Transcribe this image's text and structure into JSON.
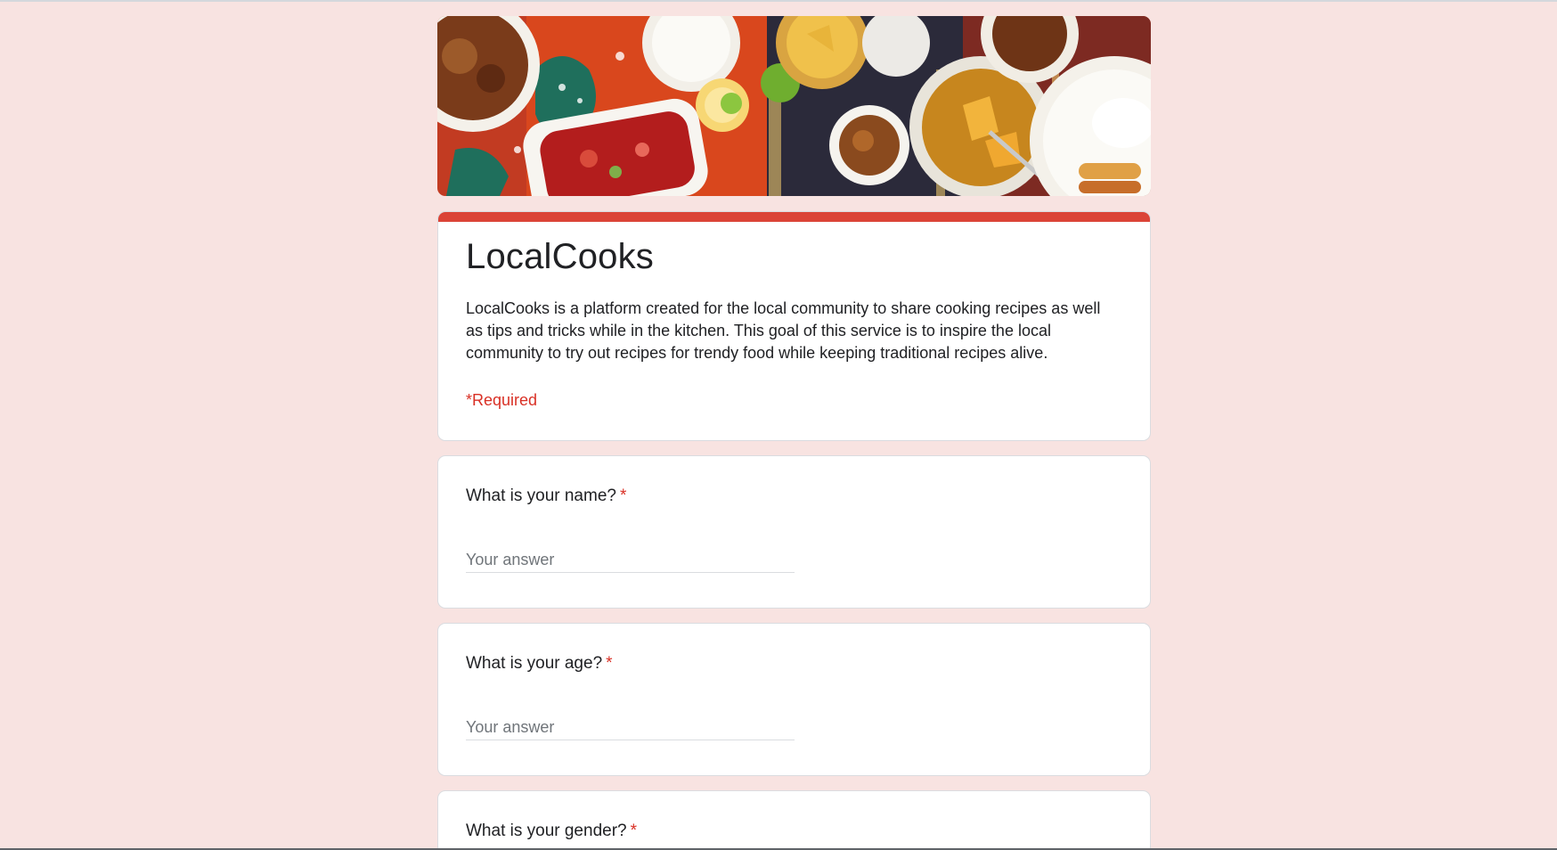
{
  "form": {
    "title": "LocalCooks",
    "description": "LocalCooks is a platform created for the local community to share cooking recipes as well as tips and tricks while in the kitchen. This goal of this service is to inspire the local community to try out recipes for trendy food while keeping traditional recipes alive.",
    "required_note": "*Required",
    "accent_color": "#db4437",
    "background_color": "#f8e3e1"
  },
  "banner": {
    "icon": "food-banner-image"
  },
  "questions": [
    {
      "label": "What is your name?",
      "required_mark": "*",
      "placeholder": "Your answer"
    },
    {
      "label": "What is your age?",
      "required_mark": "*",
      "placeholder": "Your answer"
    },
    {
      "label": "What is your gender?",
      "required_mark": "*"
    }
  ]
}
